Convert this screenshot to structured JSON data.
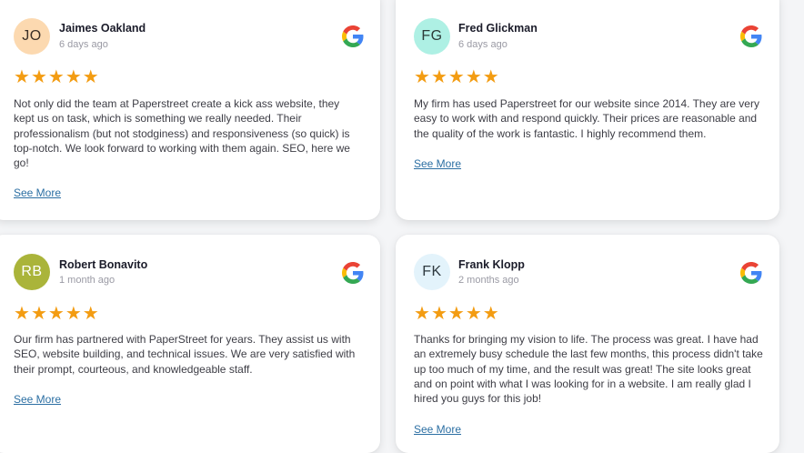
{
  "reviews": [
    {
      "initials": "JO",
      "name": "Jaimes Oakland",
      "date": "6 days ago",
      "avatar_bg": "#fcd9b0",
      "avatar_fg": "#3a2f26",
      "stars": "★★★★★",
      "text": "Not only did the team at Paperstreet create a kick ass website, they kept us on task, which is something we really needed. Their professionalism (but not stodginess) and responsiveness (so quick) is top-notch. We look forward to working with them again. SEO, here we go!",
      "see_more": "See More",
      "source_icon": "google-logo"
    },
    {
      "initials": "FG",
      "name": "Fred Glickman",
      "date": "6 days ago",
      "avatar_bg": "#aef0e4",
      "avatar_fg": "#2d3b38",
      "stars": "★★★★★",
      "text": "My firm has used Paperstreet for our website since 2014. They are very easy to work with and respond quickly. Their prices are reasonable and the quality of the work is fantastic. I highly recommend them.",
      "see_more": "See More",
      "source_icon": "google-logo"
    },
    {
      "initials": "RB",
      "name": "Robert Bonavito",
      "date": "1 month ago",
      "avatar_bg": "#aab43a",
      "avatar_fg": "#ffffff",
      "stars": "★★★★★",
      "text": "Our firm has partnered with PaperStreet for years. They assist us with SEO, website building, and technical issues. We are very satisfied with their prompt, courteous, and knowledgeable staff.",
      "see_more": "See More",
      "source_icon": "google-logo"
    },
    {
      "initials": "FK",
      "name": "Frank Klopp",
      "date": "2 months ago",
      "avatar_bg": "#e3f3fb",
      "avatar_fg": "#2f3a40",
      "stars": "★★★★★",
      "text": "Thanks for bringing my vision to life. The process was great. I have had an extremely busy schedule the last few months, this process didn't take up too much of my time, and the result was great! The site looks great and on point with what I was looking for in a website. I am really glad I hired you guys for this job!",
      "see_more": "See More",
      "source_icon": "google-logo"
    }
  ],
  "colors": {
    "star": "#f39c12",
    "link": "#2c6fa3",
    "card_bg": "#ffffff",
    "page_bg": "#f4f5f7"
  }
}
